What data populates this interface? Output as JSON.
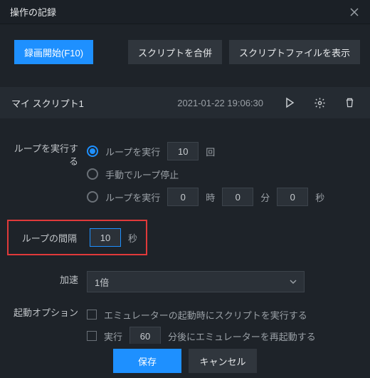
{
  "titlebar": {
    "title": "操作の記録"
  },
  "topbar": {
    "record_label": "録画開始(F10)",
    "merge_label": "スクリプトを合併",
    "show_file_label": "スクリプトファイルを表示"
  },
  "script": {
    "name": "マイ スクリプト1",
    "timestamp": "2021-01-22 19:06:30"
  },
  "loop": {
    "label": "ループを実行する",
    "option_count": {
      "prefix": "ループを実行",
      "value": "10",
      "suffix": "回"
    },
    "option_manual": "手動でループ停止",
    "option_time": {
      "prefix": "ループを実行",
      "h": "0",
      "h_unit": "時",
      "m": "0",
      "m_unit": "分",
      "s": "0",
      "s_unit": "秒"
    }
  },
  "interval": {
    "label": "ループの間隔",
    "value": "10",
    "unit": "秒"
  },
  "accel": {
    "label": "加速",
    "value": "1倍"
  },
  "startup": {
    "label": "起動オプション",
    "on_emulator_start": "エミュレーターの起動時にスクリプトを実行する",
    "run_after": {
      "prefix": "実行",
      "value": "60",
      "suffix": "分後にエミュレーターを再起動する"
    }
  },
  "footer": {
    "save": "保存",
    "cancel": "キャンセル"
  }
}
